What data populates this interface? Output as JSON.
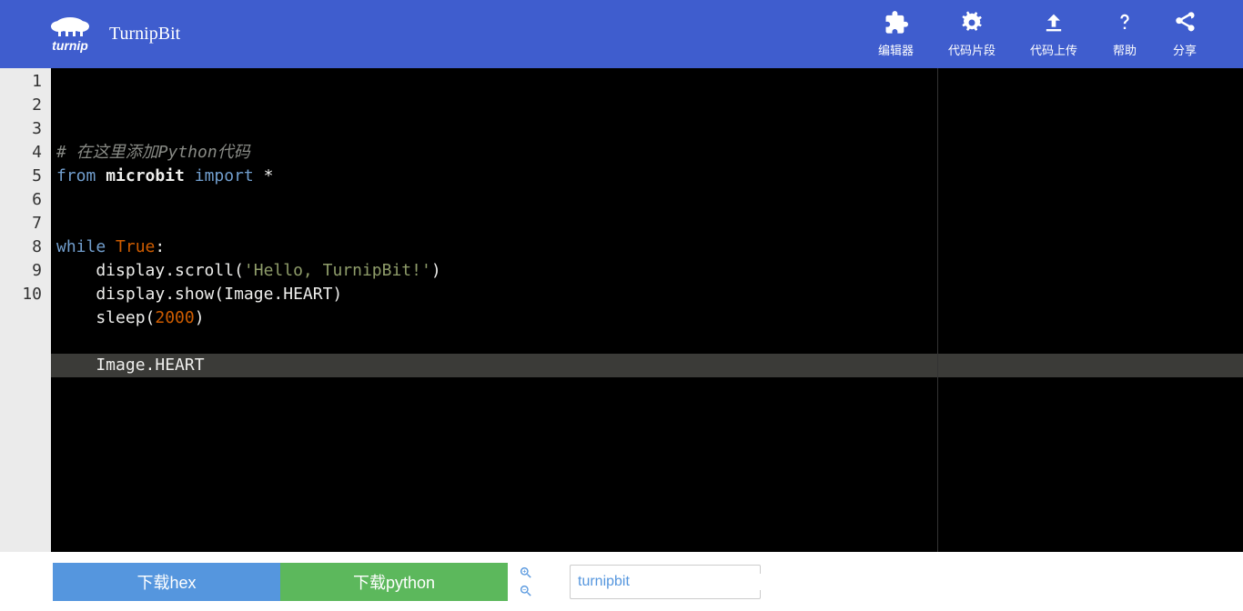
{
  "header": {
    "brand": "TurnipBit",
    "nav": [
      {
        "label": "编辑器",
        "icon": "puzzle"
      },
      {
        "label": "代码片段",
        "icon": "gears"
      },
      {
        "label": "代码上传",
        "icon": "upload"
      },
      {
        "label": "帮助",
        "icon": "question"
      },
      {
        "label": "分享",
        "icon": "share"
      }
    ]
  },
  "editor": {
    "active_line": 10,
    "lines": [
      {
        "n": 1,
        "tokens": [
          {
            "t": "# 在这里添加Python代码",
            "c": "comment"
          }
        ]
      },
      {
        "n": 2,
        "tokens": [
          {
            "t": "from ",
            "c": "kw"
          },
          {
            "t": "microbit",
            "c": "id"
          },
          {
            "t": " import ",
            "c": "kw"
          },
          {
            "t": "*",
            "c": "op"
          }
        ]
      },
      {
        "n": 3,
        "tokens": []
      },
      {
        "n": 4,
        "tokens": []
      },
      {
        "n": 5,
        "tokens": [
          {
            "t": "while ",
            "c": "kw"
          },
          {
            "t": "True",
            "c": "bool"
          },
          {
            "t": ":",
            "c": "plain"
          }
        ]
      },
      {
        "n": 6,
        "tokens": [
          {
            "t": "    display.scroll(",
            "c": "plain"
          },
          {
            "t": "'Hello, TurnipBit!'",
            "c": "str"
          },
          {
            "t": ")",
            "c": "plain"
          }
        ]
      },
      {
        "n": 7,
        "tokens": [
          {
            "t": "    display.show(Image.HEART)",
            "c": "plain"
          }
        ]
      },
      {
        "n": 8,
        "tokens": [
          {
            "t": "    sleep(",
            "c": "plain"
          },
          {
            "t": "2000",
            "c": "num"
          },
          {
            "t": ")",
            "c": "plain"
          }
        ]
      },
      {
        "n": 9,
        "tokens": []
      },
      {
        "n": 10,
        "tokens": [
          {
            "t": "    Image.HEART",
            "c": "plain"
          }
        ]
      }
    ]
  },
  "footer": {
    "download_hex": "下载hex",
    "download_py": "下载python",
    "filename": "turnipbit"
  }
}
